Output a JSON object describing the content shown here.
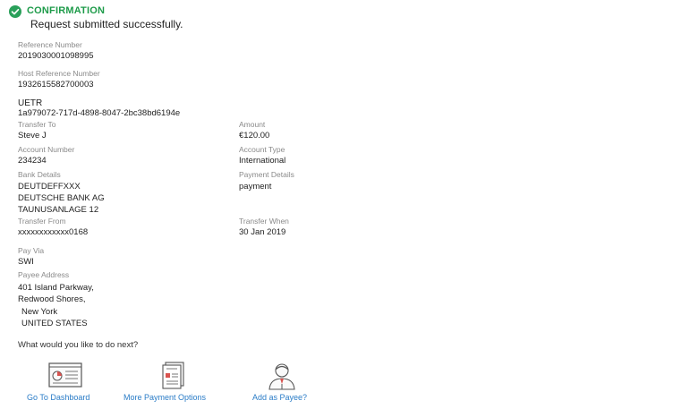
{
  "confirmation": {
    "title": "CONFIRMATION",
    "message": "Request submitted successfully.",
    "check_color": "#2aa05a"
  },
  "details": {
    "reference_number": {
      "label": "Reference Number",
      "value": "2019030001098995"
    },
    "host_reference_number": {
      "label": "Host Reference Number",
      "value": "1932615582700003"
    },
    "uetr": {
      "label": "UETR",
      "value": "1a979072-717d-4898-8047-2bc38bd6194e"
    },
    "transfer_to": {
      "label": "Transfer To",
      "value": "Steve J"
    },
    "amount": {
      "label": "Amount",
      "value": "€120.00"
    },
    "account_number": {
      "label": "Account Number",
      "value": "234234"
    },
    "account_type": {
      "label": "Account Type",
      "value": "International"
    },
    "bank_details": {
      "label": "Bank Details",
      "lines": [
        "DEUTDEFFXXX",
        "DEUTSCHE BANK AG",
        "TAUNUSANLAGE 12"
      ]
    },
    "payment_details": {
      "label": "Payment Details",
      "value": "payment"
    },
    "transfer_from": {
      "label": "Transfer From",
      "value": "xxxxxxxxxxxx0168"
    },
    "transfer_when": {
      "label": "Transfer When",
      "value": "30 Jan 2019"
    },
    "pay_via": {
      "label": "Pay Via",
      "value": "SWI"
    },
    "payee_address": {
      "label": "Payee Address",
      "lines": [
        "401 Island Parkway,",
        "Redwood Shores,",
        "New York",
        "UNITED STATES"
      ]
    }
  },
  "next_steps": {
    "prompt": "What would you like to do next?",
    "actions": [
      {
        "label": "Go To Dashboard",
        "icon": "dashboard-icon"
      },
      {
        "label": "More Payment Options",
        "icon": "payment-options-icon"
      },
      {
        "label": "Add as Payee?",
        "icon": "add-payee-icon"
      }
    ],
    "link_color": "#2a7cc7"
  }
}
